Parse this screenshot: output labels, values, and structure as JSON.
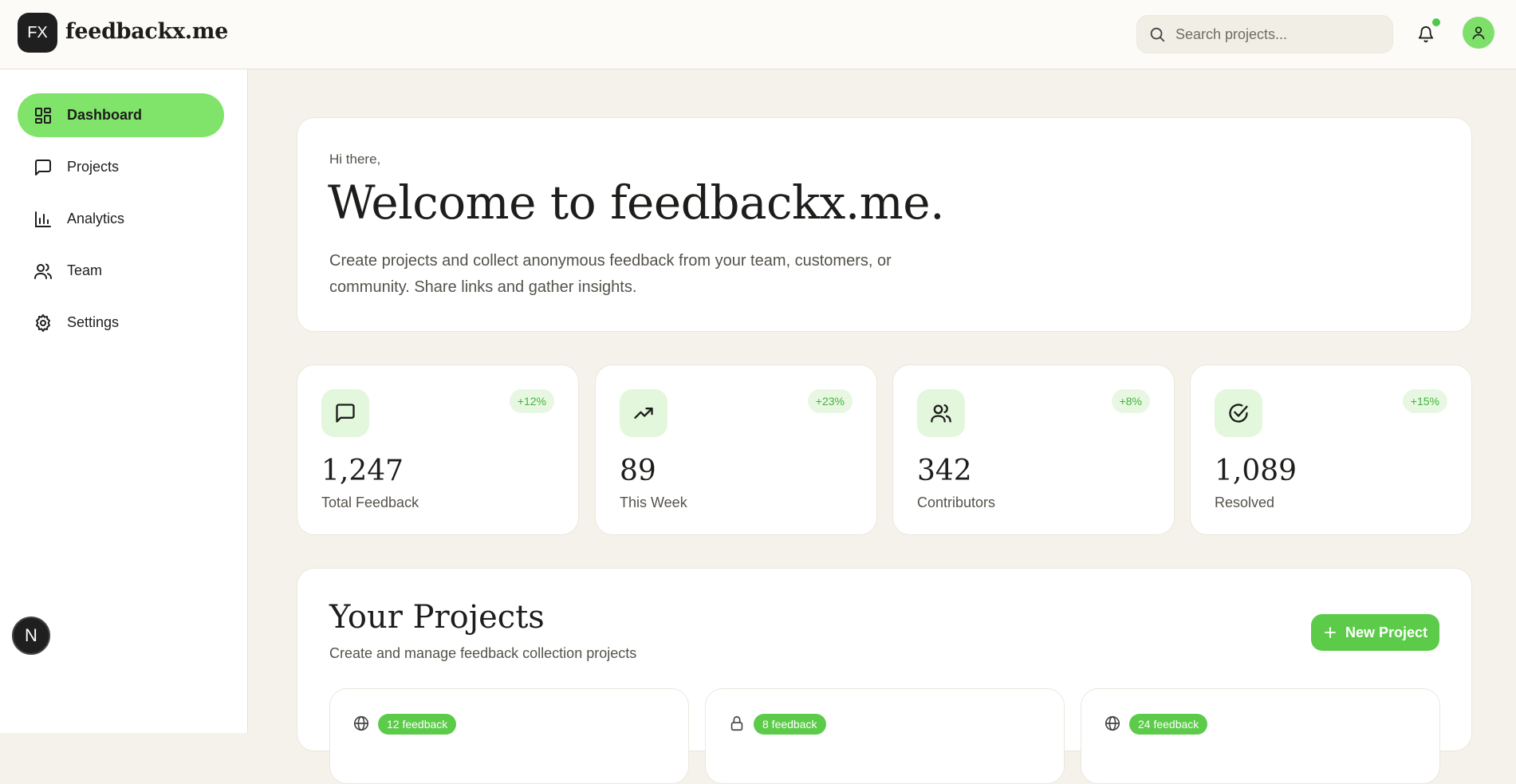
{
  "header": {
    "logo_initials": "FX",
    "brand": "feedbackx.me",
    "search_placeholder": "Search projects..."
  },
  "sidebar": {
    "items": [
      {
        "label": "Dashboard",
        "icon": "dashboard-icon",
        "active": true
      },
      {
        "label": "Projects",
        "icon": "message-square-icon",
        "active": false
      },
      {
        "label": "Analytics",
        "icon": "bar-chart-icon",
        "active": false
      },
      {
        "label": "Team",
        "icon": "users-icon",
        "active": false
      },
      {
        "label": "Settings",
        "icon": "gear-icon",
        "active": false
      }
    ],
    "footer_badge": "N"
  },
  "welcome": {
    "greeting": "Hi there,",
    "title": "Welcome to feedbackx.me.",
    "description": "Create projects and collect anonymous feedback from your team, customers, or community. Share links and gather insights."
  },
  "stats": [
    {
      "value": "1,247",
      "label": "Total Feedback",
      "change": "+12%",
      "icon": "message-square-icon"
    },
    {
      "value": "89",
      "label": "This Week",
      "change": "+23%",
      "icon": "trending-up-icon"
    },
    {
      "value": "342",
      "label": "Contributors",
      "change": "+8%",
      "icon": "users-icon"
    },
    {
      "value": "1,089",
      "label": "Resolved",
      "change": "+15%",
      "icon": "check-circle-icon"
    }
  ],
  "projects": {
    "title": "Your Projects",
    "subtitle": "Create and manage feedback collection projects",
    "new_button": "New Project",
    "cards": [
      {
        "badge": "12 feedback",
        "icon": "globe-icon"
      },
      {
        "badge": "8 feedback",
        "icon": "lock-icon"
      },
      {
        "badge": "24 feedback",
        "icon": "globe-icon"
      }
    ]
  },
  "colors": {
    "accent": "#80e36a",
    "button": "#5ccb4a",
    "background": "#f4f2ea"
  }
}
